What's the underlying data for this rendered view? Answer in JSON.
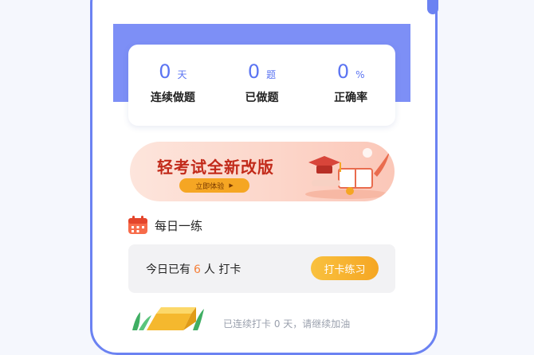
{
  "stats": [
    {
      "value": "0",
      "unit": "天",
      "label": "连续做题"
    },
    {
      "value": "0",
      "unit": "题",
      "label": "已做题"
    },
    {
      "value": "0",
      "unit": "%",
      "label": "正确率"
    }
  ],
  "banner": {
    "title": "轻考试全新改版",
    "button_label": "立即体验"
  },
  "daily": {
    "section_title": "每日一练",
    "checkin_prefix": "今日已有",
    "checkin_count": "6",
    "checkin_suffix": "人 打卡",
    "checkin_button": "打卡练习",
    "streak_text": "已连续打卡 0 天，请继续加油"
  },
  "colors": {
    "accent": "#5b74f2",
    "header": "#7d8ff6",
    "orange": "#f5a623",
    "banner_title": "#c22a1a"
  }
}
